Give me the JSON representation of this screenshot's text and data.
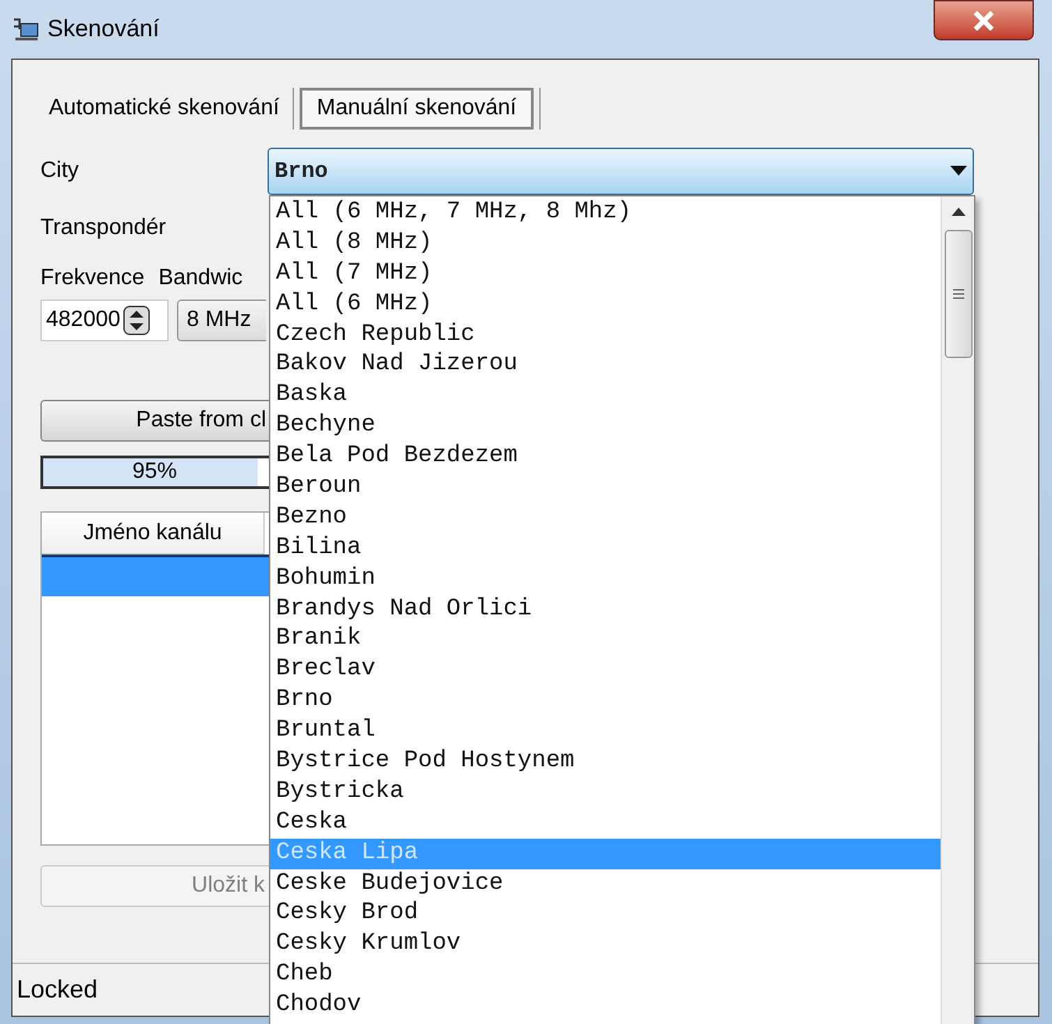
{
  "window": {
    "title": "Skenování"
  },
  "tabs": [
    {
      "label": "Automatické skenování",
      "selected": false
    },
    {
      "label": "Manuální skenování",
      "selected": true
    }
  ],
  "city": {
    "label": "City",
    "value": "Brno"
  },
  "transponder": {
    "label": "Transpondér"
  },
  "frequency": {
    "label": "Frekvence",
    "value": "482000"
  },
  "bandwidth": {
    "label": "Bandwic",
    "value": "8 MHz"
  },
  "paste_button": {
    "label": "Paste from cl"
  },
  "progress": {
    "level": 0.95,
    "reading": "95%"
  },
  "table": {
    "columns": [
      "Jméno kanálu"
    ],
    "rows": [
      {
        "selected": true
      }
    ]
  },
  "save_button": {
    "label": "Uložit k",
    "disabled": true
  },
  "status_bar": {
    "text": "Locked"
  },
  "city_options": [
    {
      "label": "All (6 MHz, 7 MHz, 8 Mhz)",
      "selected": false
    },
    {
      "label": "All (8 MHz)",
      "selected": false
    },
    {
      "label": "All (7 MHz)",
      "selected": false
    },
    {
      "label": "All (6 MHz)",
      "selected": false
    },
    {
      "label": "Czech Republic",
      "selected": false
    },
    {
      "label": "Bakov Nad Jizerou",
      "selected": false
    },
    {
      "label": "Baska",
      "selected": false
    },
    {
      "label": "Bechyne",
      "selected": false
    },
    {
      "label": "Bela Pod Bezdezem",
      "selected": false
    },
    {
      "label": "Beroun",
      "selected": false
    },
    {
      "label": "Bezno",
      "selected": false
    },
    {
      "label": "Bilina",
      "selected": false
    },
    {
      "label": "Bohumin",
      "selected": false
    },
    {
      "label": "Brandys Nad Orlici",
      "selected": false
    },
    {
      "label": "Branik",
      "selected": false
    },
    {
      "label": "Breclav",
      "selected": false
    },
    {
      "label": "Brno",
      "selected": false
    },
    {
      "label": "Bruntal",
      "selected": false
    },
    {
      "label": "Bystrice Pod Hostynem",
      "selected": false
    },
    {
      "label": "Bystricka",
      "selected": false
    },
    {
      "label": "Ceska",
      "selected": false
    },
    {
      "label": "Ceska Lipa",
      "selected": true
    },
    {
      "label": "Ceske Budejovice",
      "selected": false
    },
    {
      "label": "Cesky Brod",
      "selected": false
    },
    {
      "label": "Cesky Krumlov",
      "selected": false
    },
    {
      "label": "Cheb",
      "selected": false
    },
    {
      "label": "Chodov",
      "selected": false
    }
  ]
}
